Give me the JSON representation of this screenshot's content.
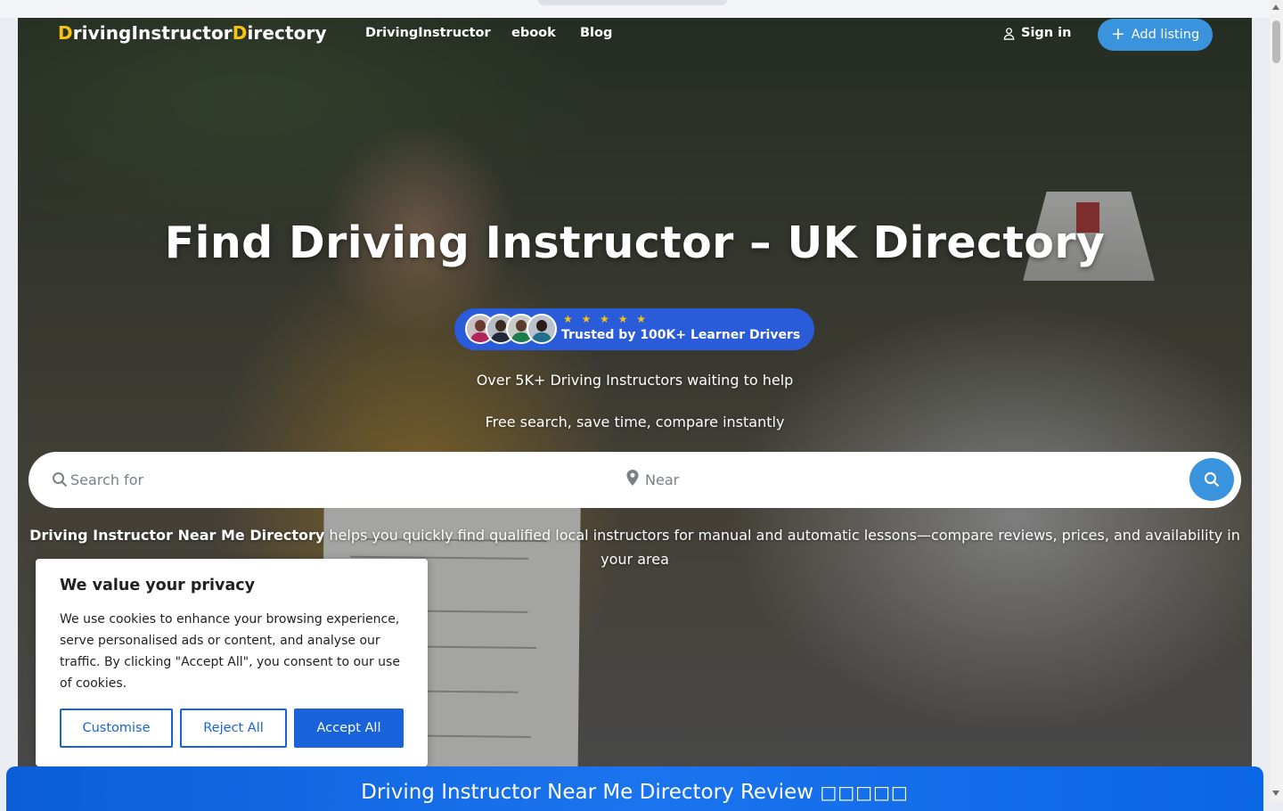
{
  "nav": {
    "logo": [
      {
        "text": "D",
        "accent": true
      },
      {
        "text": "riving",
        "accent": false
      },
      {
        "text": "Instructor",
        "accent": false
      },
      {
        "text": "D",
        "accent": true
      },
      {
        "text": "irectory",
        "accent": false
      }
    ],
    "links": [
      "DrivingInstructor",
      "ebook",
      "Blog"
    ],
    "signin_label": "Sign in",
    "add_listing_label": "Add listing"
  },
  "hero": {
    "title": "Find Driving Instructor – UK Directory",
    "rating_stars": 5,
    "stars_text": "★ ★ ★ ★ ★",
    "trust_text": "Trusted by 100K+ Learner Drivers",
    "subtitle_1": "Over 5K+ Driving Instructors waiting to help",
    "subtitle_2": "Free search, save time, compare instantly"
  },
  "search": {
    "search_placeholder": "Search for",
    "near_placeholder": "Near"
  },
  "description": {
    "bold": "Driving Instructor Near Me Directory",
    "rest": " helps you quickly find qualified local instructors for manual and automatic lessons—compare reviews, prices, and availability in your area"
  },
  "cookie": {
    "title": "We value your privacy",
    "body": "We use cookies to enhance your browsing experience, serve personalised ads or content, and analyse our traffic. By clicking \"Accept All\", you consent to our use of cookies.",
    "customise_label": "Customise",
    "reject_label": "Reject All",
    "accept_label": "Accept All"
  },
  "review_bar": {
    "text": "Driving Instructor Near Me Directory Review",
    "glyphs": "□□□□□"
  },
  "colors": {
    "accent_yellow": "#f9c312",
    "button_blue": "#3a93dd",
    "trust_blue": "#2a5bd8",
    "cookie_blue": "#1863dc"
  }
}
